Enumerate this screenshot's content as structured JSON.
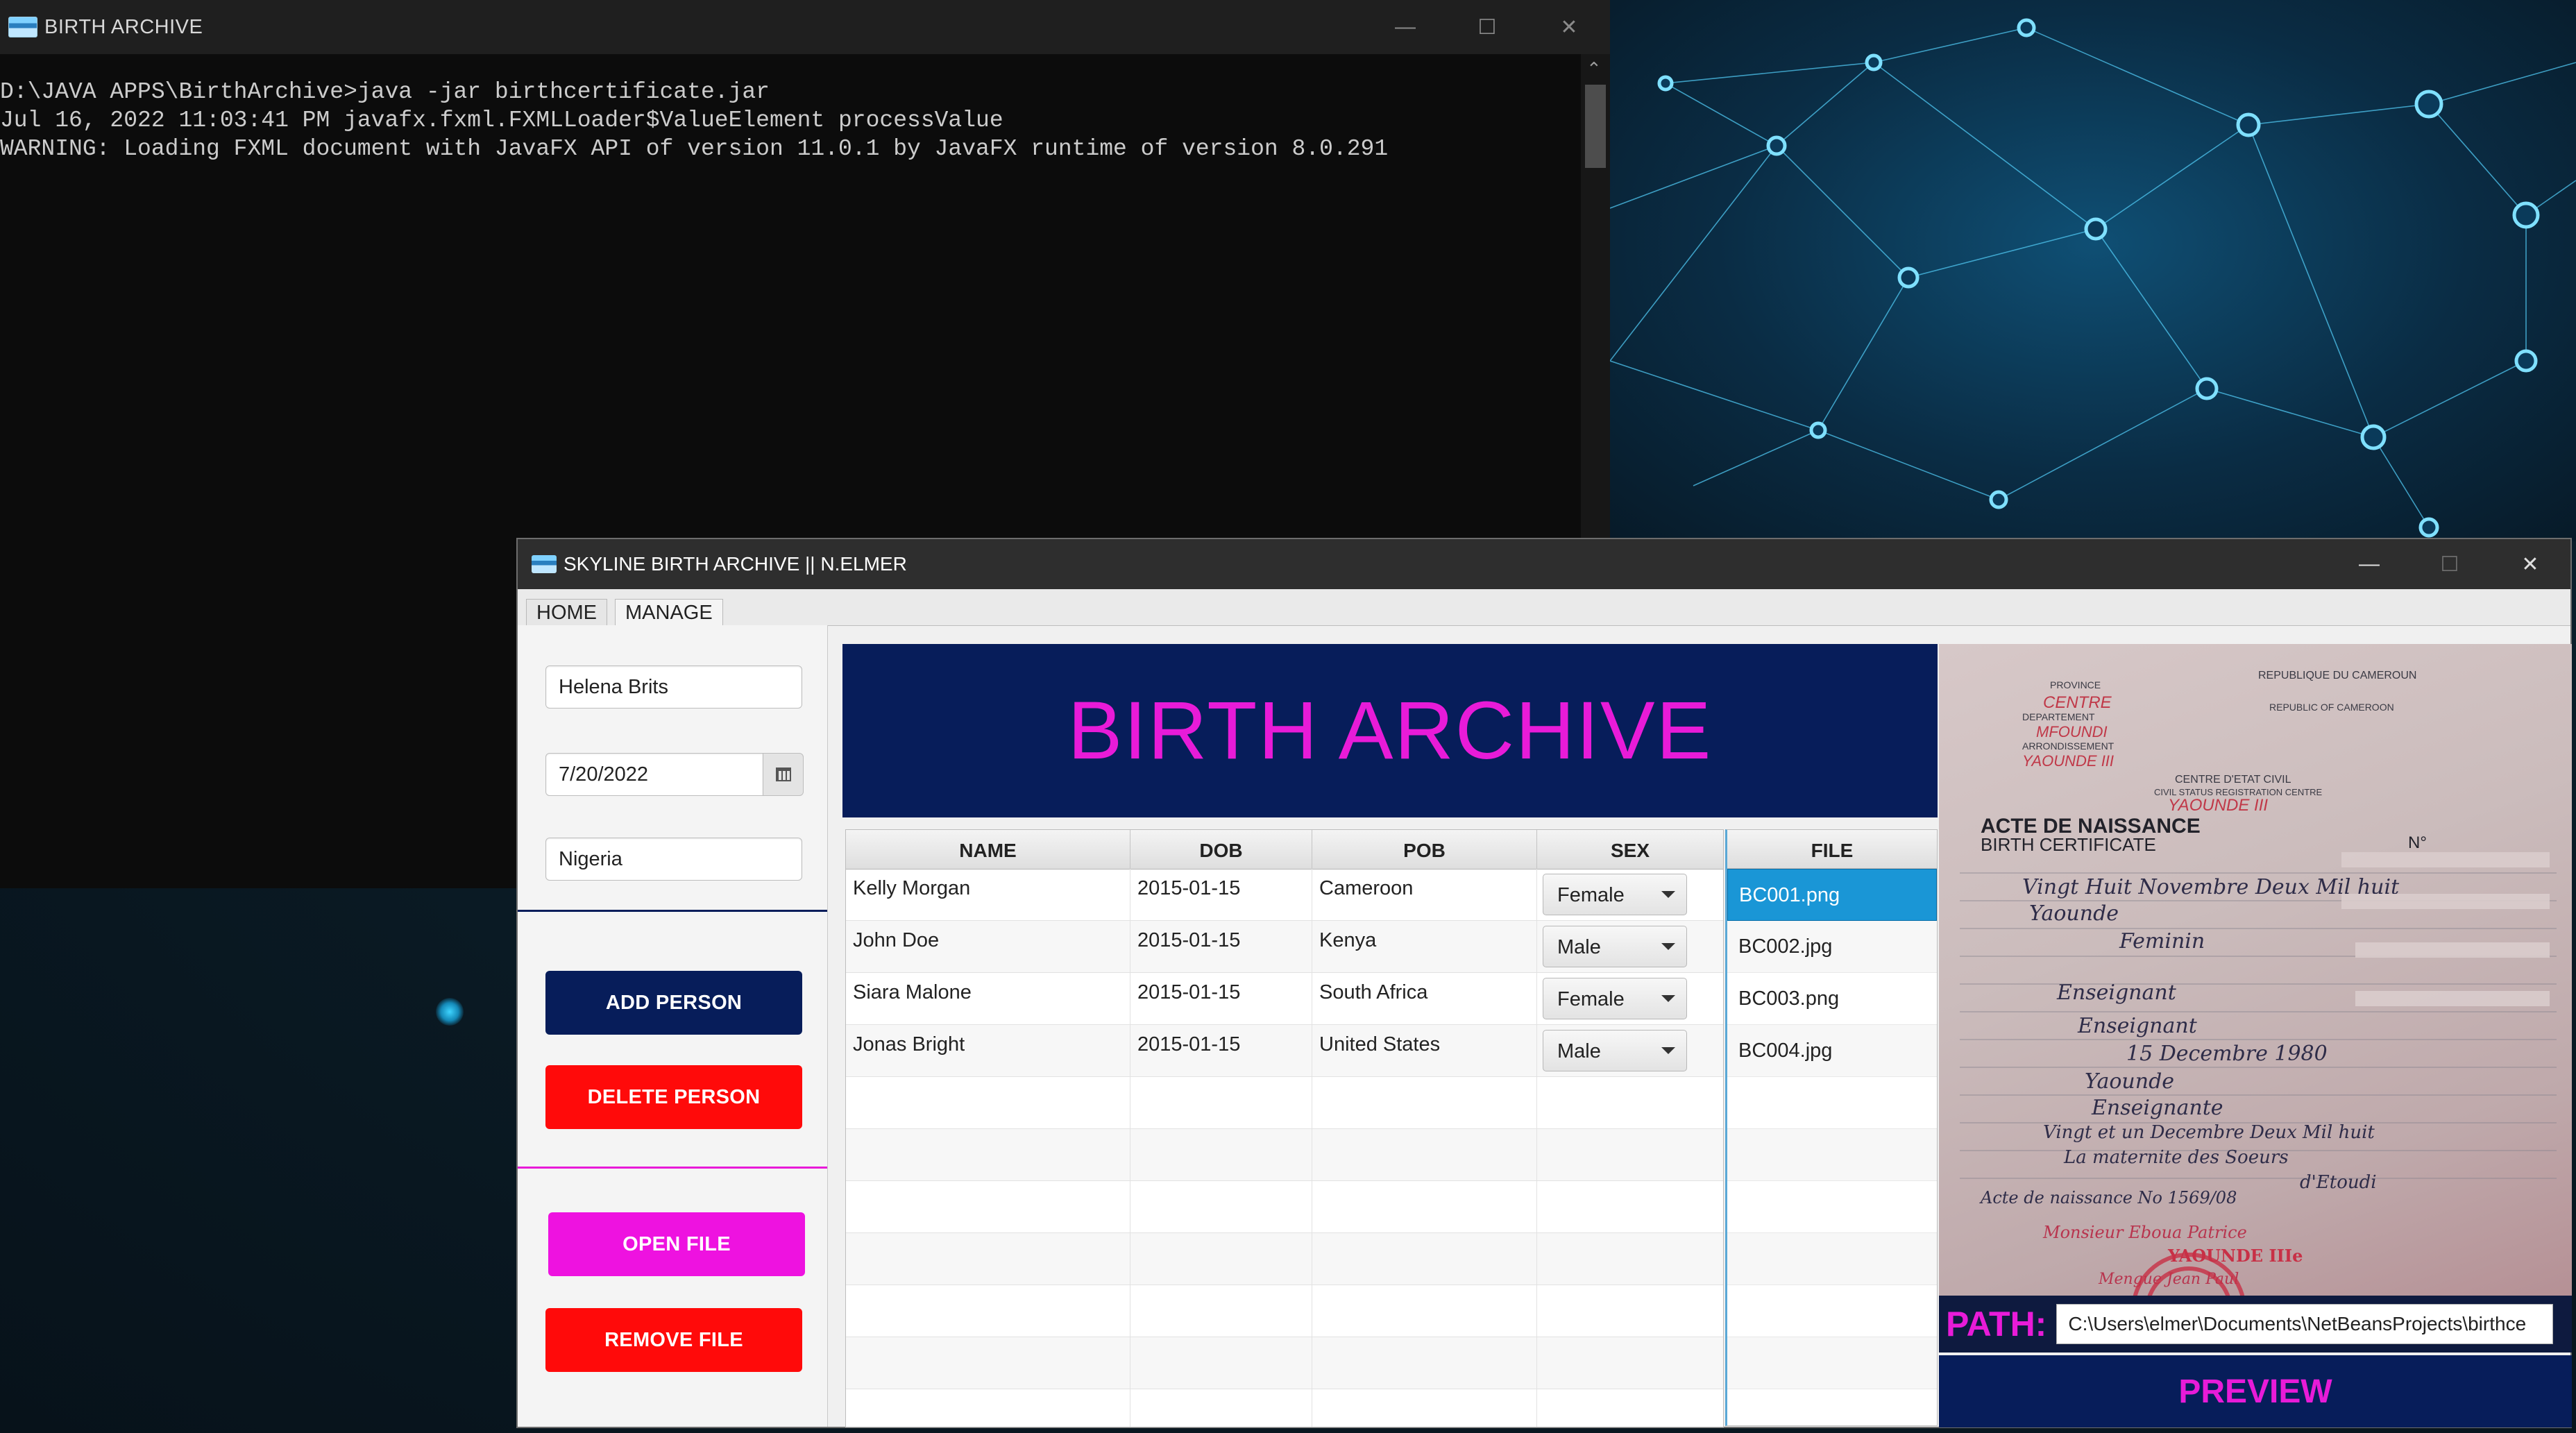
{
  "console": {
    "title": "BIRTH ARCHIVE",
    "lines": [
      "D:\\JAVA APPS\\BirthArchive>java -jar birthcertificate.jar",
      "Jul 16, 2022 11:03:41 PM javafx.fxml.FXMLLoader$ValueElement processValue",
      "WARNING: Loading FXML document with JavaFX API of version 11.0.1 by JavaFX runtime of version 8.0.291"
    ]
  },
  "app": {
    "title": "SKYLINE BIRTH ARCHIVE || N.ELMER",
    "tabs": [
      {
        "label": "HOME"
      },
      {
        "label": "MANAGE"
      }
    ],
    "form": {
      "name_value": "Helena Brits",
      "date_value": "7/20/2022",
      "place_value": "Nigeria"
    },
    "buttons": {
      "add_person": "ADD PERSON",
      "delete_person": "DELETE PERSON",
      "open_file": "OPEN FILE",
      "remove_file": "REMOVE FILE",
      "preview": "PREVIEW"
    },
    "colors": {
      "navy": "#071d5a",
      "red": "#ff0a0a",
      "magenta": "#ee12e0",
      "selection_blue": "#1a96d6"
    },
    "banner_title": "BIRTH ARCHIVE",
    "table": {
      "columns": [
        "NAME",
        "DOB",
        "POB",
        "SEX"
      ],
      "rows": [
        {
          "name": "Kelly Morgan",
          "dob": "2015-01-15",
          "pob": "Cameroon",
          "sex": "Female"
        },
        {
          "name": "John Doe",
          "dob": "2015-01-15",
          "pob": "Kenya",
          "sex": "Male"
        },
        {
          "name": "Siara Malone",
          "dob": "2015-01-15",
          "pob": "South Africa",
          "sex": "Female"
        },
        {
          "name": "Jonas Bright",
          "dob": "2015-01-15",
          "pob": "United States",
          "sex": "Male"
        }
      ]
    },
    "files": {
      "header": "FILE",
      "items": [
        "BC001.png",
        "BC002.jpg",
        "BC003.png",
        "BC004.jpg"
      ],
      "selected": "BC001.png"
    },
    "path": {
      "label": "PATH:",
      "value": "C:\\Users\\elmer\\Documents\\NetBeansProjects\\birthce"
    },
    "certificate": {
      "province": "PROVINCE",
      "province_value": "CENTRE",
      "department": "DEPARTEMENT",
      "department_value": "MFOUNDI",
      "district": "ARRONDISSEMENT",
      "district_value": "YAOUNDE III",
      "republic": "REPUBLIQUE DU CAMEROUN",
      "republic_en": "REPUBLIC OF CAMEROON",
      "centre": "CENTRE D'ETAT CIVIL",
      "centre_en": "CIVIL STATUS REGISTRATION CENTRE",
      "centre_value": "YAOUNDE III",
      "heading": "ACTE DE NAISSANCE",
      "heading_en": "BIRTH CERTIFICATE",
      "number_label": "N°",
      "entries": [
        "Vingt Huit Novembre Deux Mil huit",
        "Yaounde",
        "Feminin",
        "Enseignant",
        "Enseignant",
        "15 Decembre 1980",
        "Yaounde",
        "Enseignante",
        "Vingt et un Decembre Deux Mil huit",
        "La maternite des Soeurs",
        "d'Etoudi",
        "Acte de naissance No 1569/08"
      ],
      "signature": "Monsieur Eboua Patrice",
      "stamp": "YAOUNDE IIIe",
      "signature2": "Mengue Jean Paul"
    }
  }
}
